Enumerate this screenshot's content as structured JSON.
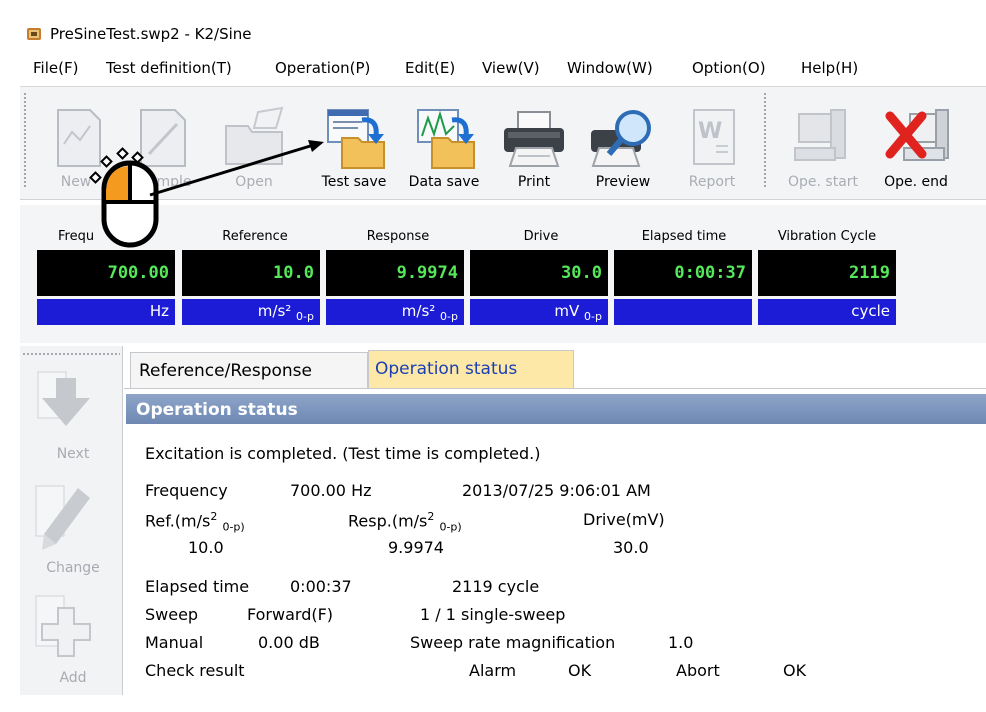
{
  "window": {
    "title": "PreSineTest.swp2 - K2/Sine"
  },
  "menu": [
    "File(F)",
    "Test definition(T)",
    "Operation(P)",
    "Edit(E)",
    "View(V)",
    "Window(W)",
    "Option(O)",
    "Help(H)"
  ],
  "toolbar": {
    "buttons": [
      {
        "label": "New",
        "icon": "new-document-icon",
        "enabled": false
      },
      {
        "label": "Sample",
        "icon": "sample-document-icon",
        "enabled": false
      },
      {
        "label": "Open",
        "icon": "open-folder-icon",
        "enabled": false
      },
      {
        "label": "Test save",
        "icon": "test-save-icon",
        "enabled": true
      },
      {
        "label": "Data save",
        "icon": "data-save-icon",
        "enabled": true
      },
      {
        "label": "Print",
        "icon": "printer-icon",
        "enabled": true
      },
      {
        "label": "Preview",
        "icon": "magnifier-preview-icon",
        "enabled": true
      },
      {
        "label": "Report",
        "icon": "word-report-icon",
        "enabled": false
      },
      {
        "label": "Ope. start",
        "icon": "operation-start-icon",
        "enabled": false
      },
      {
        "label": "Ope. end",
        "icon": "operation-end-icon",
        "enabled": true
      }
    ],
    "new_label_visible": "New",
    "sample_label_visible": "mple"
  },
  "status_panel": {
    "columns": [
      {
        "label": "Frequ",
        "value": "700.00",
        "unit": "Hz",
        "unit_sub": ""
      },
      {
        "label": "Reference",
        "value": "10.0",
        "unit": "m/s² ",
        "unit_sub": "0-p"
      },
      {
        "label": "Response",
        "value": "9.9974",
        "unit": "m/s² ",
        "unit_sub": "0-p"
      },
      {
        "label": "Drive",
        "value": "30.0",
        "unit": "mV ",
        "unit_sub": "0-p"
      },
      {
        "label": "Elapsed time",
        "value": "0:00:37",
        "unit": "",
        "unit_sub": ""
      },
      {
        "label": "Vibration Cycle",
        "value": "2119",
        "unit": "cycle",
        "unit_sub": ""
      }
    ],
    "value_color": "#55e85a",
    "unit_bg": "#1c1cd6"
  },
  "sidebar": {
    "buttons": [
      {
        "label": "Next",
        "icon": "down-arrow-icon"
      },
      {
        "label": "Change",
        "icon": "pencil-icon"
      },
      {
        "label": "Add",
        "icon": "plus-icon"
      }
    ]
  },
  "tabs": [
    {
      "label": "Reference/Response",
      "active": false
    },
    {
      "label": "Operation status",
      "active": true
    }
  ],
  "operation_status": {
    "header": "Operation status",
    "message": "Excitation is completed. (Test time is completed.)",
    "frequency_label": "Frequency",
    "frequency_value": "700.00 Hz",
    "datetime": "2013/07/25 9:06:01 AM",
    "ref_label": "Ref.(m/s",
    "ref_label_tail": "0-p)",
    "resp_label": "Resp.(m/s",
    "resp_label_tail": "0-p)",
    "drive_label": "Drive(mV)",
    "ref_value": "10.0",
    "resp_value": "9.9974",
    "drive_value": "30.0",
    "elapsed_label": "Elapsed time",
    "elapsed_value": "0:00:37",
    "cycle_value": "2119 cycle",
    "sweep_label": "Sweep",
    "sweep_value": "Forward(F)",
    "sweep_count": "1 / 1 single-sweep",
    "manual_label": "Manual",
    "manual_value": "0.00 dB",
    "rate_label": "Sweep rate magnification",
    "rate_value": "1.0",
    "check_label": "Check result",
    "alarm_label": "Alarm",
    "alarm_value": "OK",
    "abort_label": "Abort",
    "abort_value": "OK"
  }
}
